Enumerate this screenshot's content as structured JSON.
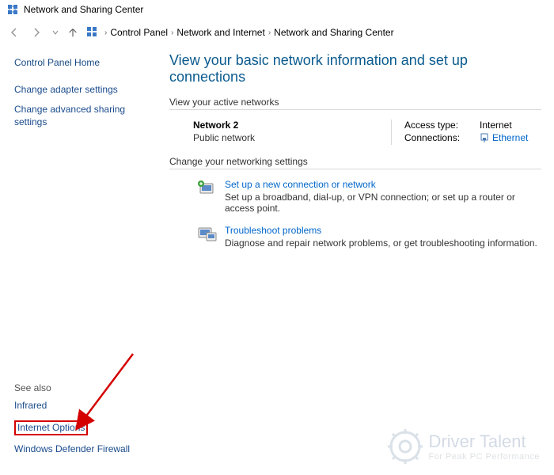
{
  "window": {
    "title": "Network and Sharing Center"
  },
  "breadcrumb": {
    "items": [
      "Control Panel",
      "Network and Internet",
      "Network and Sharing Center"
    ]
  },
  "sidebar": {
    "home": "Control Panel Home",
    "links": [
      "Change adapter settings",
      "Change advanced sharing settings"
    ],
    "see_also_label": "See also",
    "see_also": [
      "Infrared",
      "Internet Options",
      "Windows Defender Firewall"
    ]
  },
  "content": {
    "heading": "View your basic network information and set up connections",
    "active_label": "View your active networks",
    "network": {
      "name": "Network 2",
      "type": "Public network",
      "access_label": "Access type:",
      "access_value": "Internet",
      "conn_label": "Connections:",
      "conn_value": "Ethernet"
    },
    "change_label": "Change your networking settings",
    "items": [
      {
        "title": "Set up a new connection or network",
        "desc": "Set up a broadband, dial-up, or VPN connection; or set up a router or access point."
      },
      {
        "title": "Troubleshoot problems",
        "desc": "Diagnose and repair network problems, or get troubleshooting information."
      }
    ]
  },
  "watermark": {
    "line1": "Driver Talent",
    "line2": "For Peak PC Performance"
  }
}
